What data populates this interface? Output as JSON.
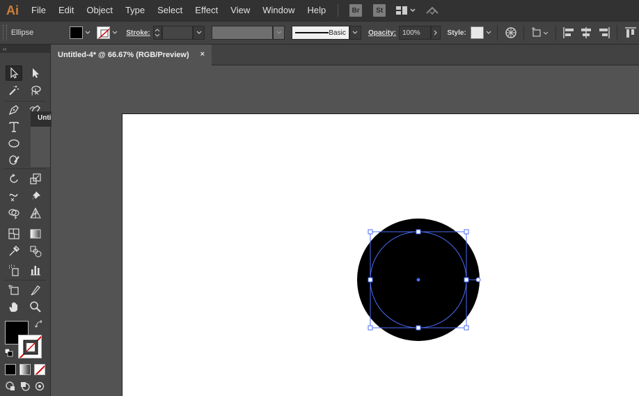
{
  "app": {
    "logo": "Ai",
    "menu": [
      "File",
      "Edit",
      "Object",
      "Type",
      "Select",
      "Effect",
      "View",
      "Window",
      "Help"
    ],
    "bridge_badge": "Br",
    "stock_badge": "St"
  },
  "control_bar": {
    "selection_type": "Ellipse",
    "stroke_label": "Stroke:",
    "brush_label": "Basic",
    "opacity_label": "Opacity:",
    "opacity_value": "100%",
    "style_label": "Style:",
    "fill_color": "#000000",
    "stroke_color": "none"
  },
  "document": {
    "tab_title": "Untitled-4* @ 66.67% (RGB/Preview)",
    "close_glyph": "×"
  },
  "tooltip": {
    "text": "Untitled-"
  },
  "tools": {
    "active": "selection-tool",
    "fill_color": "#000000",
    "stroke_color": "none",
    "collapse_glyph": "‹‹"
  },
  "colors": {
    "accent_selection": "#4a6cf7",
    "app_logo": "#d17f36"
  }
}
